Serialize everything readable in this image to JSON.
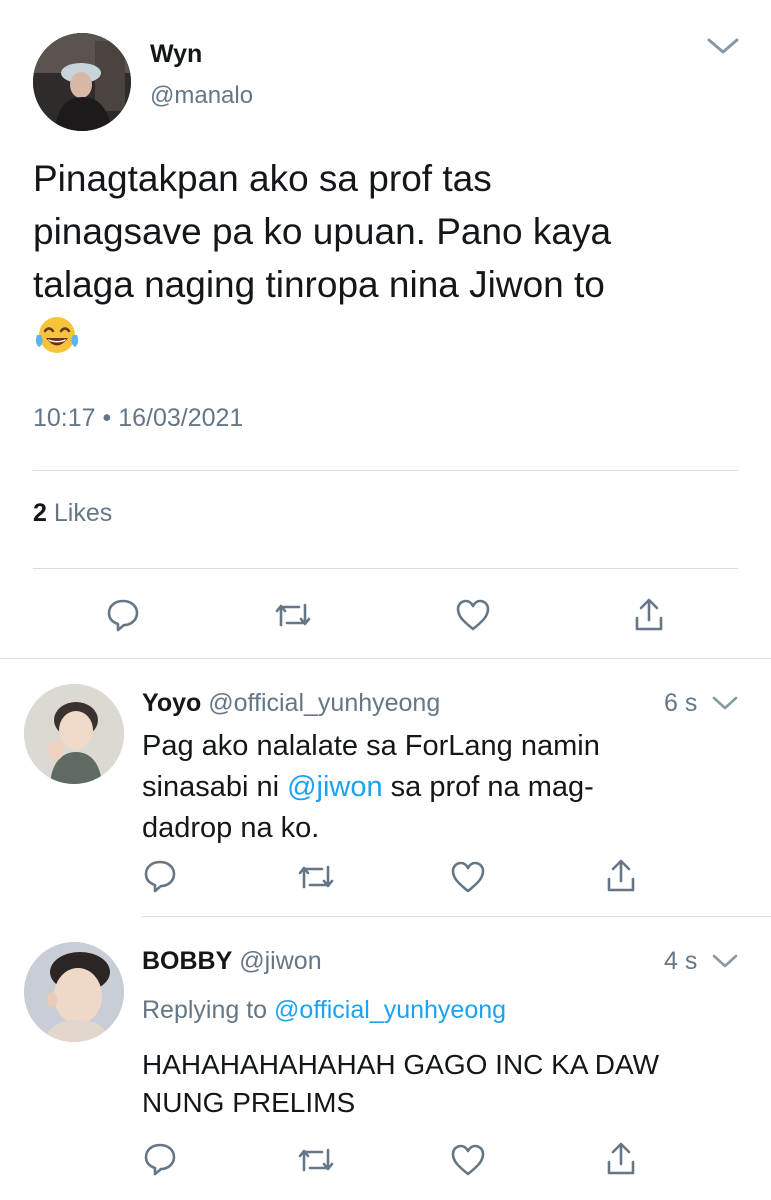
{
  "main_tweet": {
    "name": "Wyn",
    "handle": "@manalo",
    "text_lines": [
      "Pinagtakpan ako sa prof tas",
      "pinagsave pa ko upuan. Pano kaya",
      "talaga naging tinropa nina Jiwon to"
    ],
    "emoji": "😂",
    "timestamp": "10:17 • 16/03/2021",
    "likes_count": "2",
    "likes_label": "Likes"
  },
  "replies": [
    {
      "name": "Yoyo",
      "handle": "@official_yunhyeong",
      "time": "6 s",
      "line1": "Pag ako nalalate sa ForLang namin",
      "line2_before": "sinasabi ni ",
      "line2_mention": "@jiwon",
      "line2_after": " sa prof na mag-",
      "line3": "dadrop na ko."
    },
    {
      "name": "BOBBY",
      "handle": "@jiwon",
      "time": "4 s",
      "replying_label": "Replying to",
      "replying_to": "@official_yunhyeong",
      "line1": "HAHAHAHAHAHAH GAGO INC KA DAW",
      "line2": "NUNG PRELIMS"
    }
  ],
  "colors": {
    "text": "#14171a",
    "secondary": "#657786",
    "accent": "#1da1f2",
    "divider": "#d9dee2"
  },
  "icons": [
    "chevron-down-icon",
    "reply-icon",
    "retweet-icon",
    "like-icon",
    "share-icon"
  ]
}
